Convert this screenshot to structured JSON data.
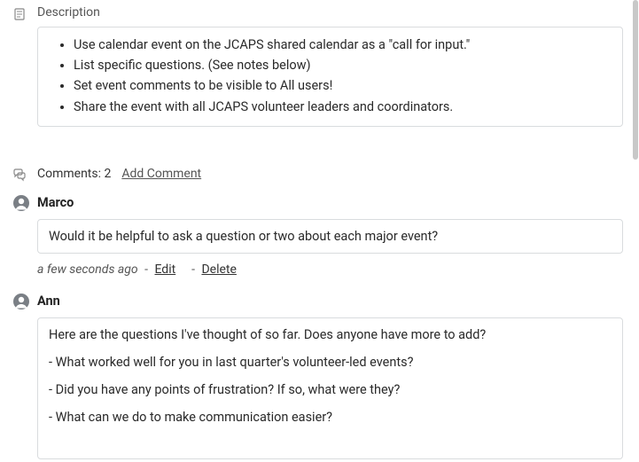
{
  "description": {
    "label": "Description",
    "items": [
      "Use calendar event on the JCAPS shared calendar as a \"call for input.\"",
      "List specific questions. (See notes below)",
      "Set event comments to be visible to All users!",
      "Share the event with all JCAPS volunteer leaders and coordinators."
    ]
  },
  "comments": {
    "count_label": "Comments: 2",
    "add_label": "Add Comment",
    "list": [
      {
        "author": "Marco",
        "body_lines": [
          "Would it be helpful to ask a question or two about each major event?"
        ],
        "timestamp": "a few seconds ago",
        "edit_label": "Edit",
        "delete_label": "Delete",
        "show_meta": true
      },
      {
        "author": "Ann",
        "body_lines": [
          "Here are the questions I've thought of so far. Does anyone have more to add?",
          "- What worked well for you in last quarter's volunteer-led events?",
          "- Did you have any points of frustration? If so, what were they?",
          "- What can we do to make communication easier?"
        ],
        "timestamp": "",
        "edit_label": "",
        "delete_label": "",
        "show_meta": false
      }
    ]
  }
}
